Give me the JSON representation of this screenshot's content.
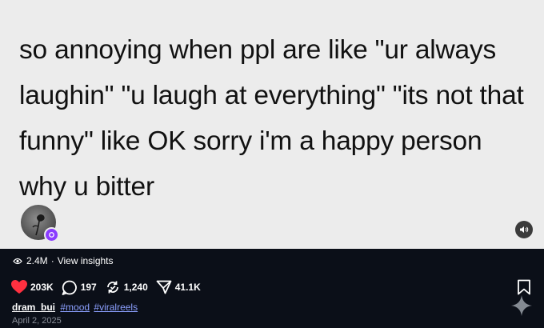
{
  "post": {
    "text": "so annoying when ppl are like \"ur always laughin\" \"u laugh at everything\" \"its not that funny\" like OK sorry i'm a happy person why u bitter"
  },
  "insights": {
    "views": "2.4M",
    "separator": "·",
    "label": "View insights"
  },
  "stats": {
    "likes": "203K",
    "comments": "197",
    "reposts": "1,240",
    "shares": "41.1K"
  },
  "caption": {
    "username": "dram_bui",
    "hashtags": [
      "#mood",
      "#viralreels"
    ],
    "date": "April 2, 2025"
  },
  "colors": {
    "like_red": "#ff3040",
    "hashtag_blue": "#8ca0ff",
    "badge_purple": "#8a3bff"
  },
  "icons": [
    "eye-icon",
    "heart-icon",
    "comment-icon",
    "repost-icon",
    "share-icon",
    "bookmark-icon",
    "sound-icon",
    "sparkle-icon"
  ]
}
